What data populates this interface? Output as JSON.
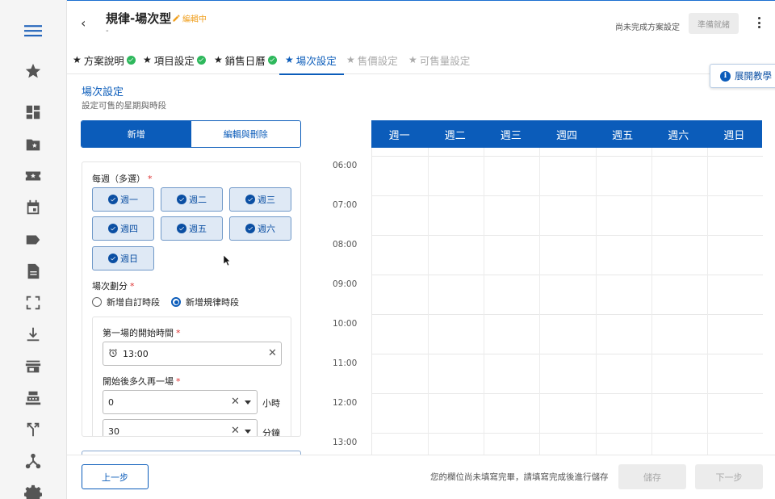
{
  "header": {
    "back": "‹",
    "title": "規律-場次型",
    "subtitle": "-",
    "status": "編輯中",
    "incomplete_note": "尚未完成方案設定",
    "ready_label": "準備就緒"
  },
  "tabs": [
    {
      "label": "方案說明",
      "state": "done"
    },
    {
      "label": "項目設定",
      "state": "done"
    },
    {
      "label": "銷售日曆",
      "state": "done"
    },
    {
      "label": "場次設定",
      "state": "active"
    },
    {
      "label": "售價設定",
      "state": "disabled"
    },
    {
      "label": "可售量設定",
      "state": "disabled"
    }
  ],
  "guide_label": "展開教學",
  "section": {
    "title": "場次設定",
    "subtitle": "設定可售的星期與時段"
  },
  "mode_toggle": {
    "add": "新增",
    "edit": "編輯與刪除"
  },
  "form": {
    "weekly_label": "每週（多選）",
    "days": [
      "週一",
      "週二",
      "週三",
      "週四",
      "週五",
      "週六",
      "週日"
    ],
    "split_label": "場次劃分",
    "radio_custom": "新增自訂時段",
    "radio_regular": "新增規律時段",
    "first_start_label": "第一場的開始時間",
    "first_start_value": "13:00",
    "interval_label": "開始後多久再一場",
    "hours_value": "0",
    "hours_unit": "小時",
    "minutes_value": "30",
    "minutes_unit": "分鐘",
    "required_mark": "*"
  },
  "calendar": {
    "days": [
      "週一",
      "週二",
      "週三",
      "週四",
      "週五",
      "週六",
      "週日"
    ],
    "times": [
      "06:00",
      "07:00",
      "08:00",
      "09:00",
      "10:00",
      "11:00",
      "12:00",
      "13:00"
    ]
  },
  "footer": {
    "prev": "上一步",
    "message": "您的欄位尚未填寫完畢，請填寫完成後進行儲存",
    "save": "儲存",
    "next": "下一步"
  },
  "colors": {
    "primary": "#0b5cba",
    "success": "#2eb85c",
    "warning": "#f0a020",
    "required": "#d33333"
  }
}
